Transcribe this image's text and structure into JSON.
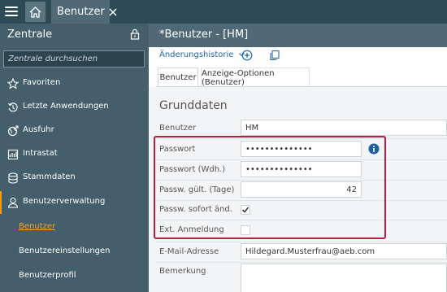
{
  "topbar": {
    "tab_label": "Benutzer"
  },
  "sidebar": {
    "title": "Zentrale",
    "search_placeholder": "Zentrale durchsuchen",
    "items": [
      {
        "label": "Favoriten",
        "icon": "star-icon"
      },
      {
        "label": "Letzte Anwendungen",
        "icon": "history-icon"
      },
      {
        "label": "Ausfuhr",
        "icon": "globe-icon"
      },
      {
        "label": "Intrastat",
        "icon": "chart-icon"
      },
      {
        "label": "Stammdaten",
        "icon": "database-icon"
      },
      {
        "label": "Benutzerverwaltung",
        "icon": "user-icon"
      }
    ],
    "subitems": [
      {
        "label": "Benutzer"
      },
      {
        "label": "Benutzereinstellungen"
      },
      {
        "label": "Benutzerprofil"
      }
    ]
  },
  "main": {
    "title": "*Benutzer - [HM]",
    "history_label": "Änderungshistorie",
    "tabs": [
      {
        "label": "Benutzer"
      },
      {
        "label": "Anzeige-Optionen (Benutzer)"
      }
    ],
    "section_title": "Grunddaten",
    "fields": {
      "benutzer": {
        "label": "Benutzer",
        "value": "HM"
      },
      "passwort": {
        "label": "Passwort",
        "value": "••••••••••••••"
      },
      "passwort_wdh": {
        "label": "Passwort (Wdh.)",
        "value": "••••••••••••••"
      },
      "passw_gult": {
        "label": "Passw. gült. (Tage)",
        "value": "42"
      },
      "passw_sofort": {
        "label": "Passw. sofort änd.",
        "checked": true
      },
      "ext_anmeldung": {
        "label": "Ext. Anmeldung",
        "checked": false
      },
      "email": {
        "label": "E-Mail-Adresse",
        "value": "Hildegard.Musterfrau@aeb.com"
      },
      "bemerkung": {
        "label": "Bemerkung",
        "value": ""
      }
    }
  },
  "colors": {
    "topbar": "#2e4a57",
    "sidebar": "#445f6b",
    "header": "#4f6a76",
    "accent": "#f0a127",
    "link": "#2266a8",
    "highlight": "#b51f44"
  }
}
